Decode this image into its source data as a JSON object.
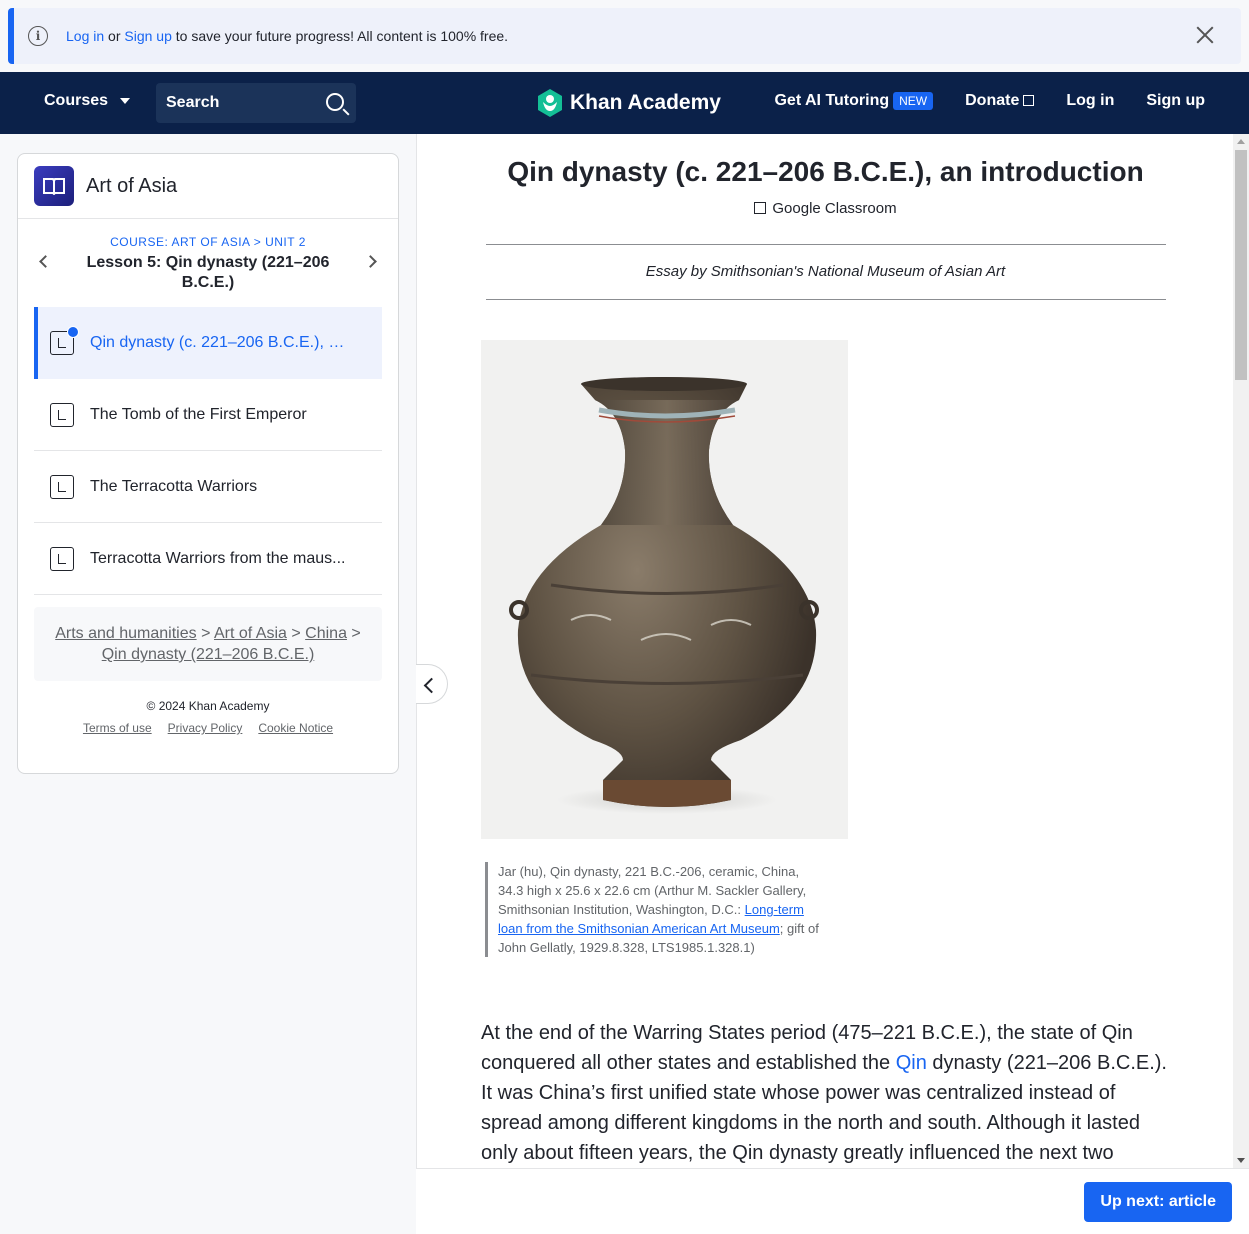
{
  "banner": {
    "login": "Log in",
    "or": "or",
    "signup": "Sign up",
    "rest": "to save your future progress! All content is 100% free."
  },
  "header": {
    "courses": "Courses",
    "search_placeholder": "Search",
    "logo": "Khan Academy",
    "tutoring": "Get AI Tutoring",
    "new_badge": "NEW",
    "donate": "Donate",
    "login": "Log in",
    "signup": "Sign up"
  },
  "sidebar": {
    "course_title": "Art of Asia",
    "crumb_course": "COURSE: ART OF ASIA",
    "crumb_sep": ">",
    "crumb_unit": "UNIT 2",
    "lesson_title": "Lesson 5: Qin dynasty (221–206 B.C.E.)",
    "items": [
      {
        "label": "Qin dynasty (c. 221–206 B.C.E.), an..."
      },
      {
        "label": "The Tomb of the First Emperor"
      },
      {
        "label": "The Terracotta Warriors"
      },
      {
        "label": "Terracotta Warriors from the maus..."
      }
    ],
    "breadcrumbs": {
      "b1": "Arts and humanities",
      "b2": "Art of Asia",
      "b3": "China",
      "b4": "Qin dynasty (221–206 B.C.E.)",
      "sep": ">"
    },
    "copyright": "© 2024 Khan Academy",
    "terms": "Terms of use",
    "privacy": "Privacy Policy",
    "cookie": "Cookie Notice"
  },
  "article": {
    "title": "Qin dynasty (c. 221–206 B.C.E.), an introduction",
    "google_classroom": "Google Classroom",
    "essay_by": "Essay by Smithsonian's National Museum of Asian Art",
    "caption_pre": "Jar (hu), Qin dynasty, 221 B.C.-206, ceramic, China, 34.3 high x 25.6 x 22.6 cm (Arthur M. Sackler Gallery, Smithsonian Institution, Washington, D.C.:",
    "caption_link": "Long-term loan from the Smithsonian American Art Museum",
    "caption_post": "; gift of John Gellatly, 1929.8.328, LTS1985.1.328.1)",
    "para_pre": "At the end of the Warring States period (475–221 B.C.E.), the state of Qin conquered all other states and established the",
    "para_link": "Qin",
    "para_post": "dynasty (221–206 B.C.E.). It was China’s first unified state whose power was centralized instead of spread among different kingdoms in the north and south. Although it lasted only about fifteen years, the Qin dynasty greatly influenced the next two"
  },
  "up_next": "Up next: article"
}
